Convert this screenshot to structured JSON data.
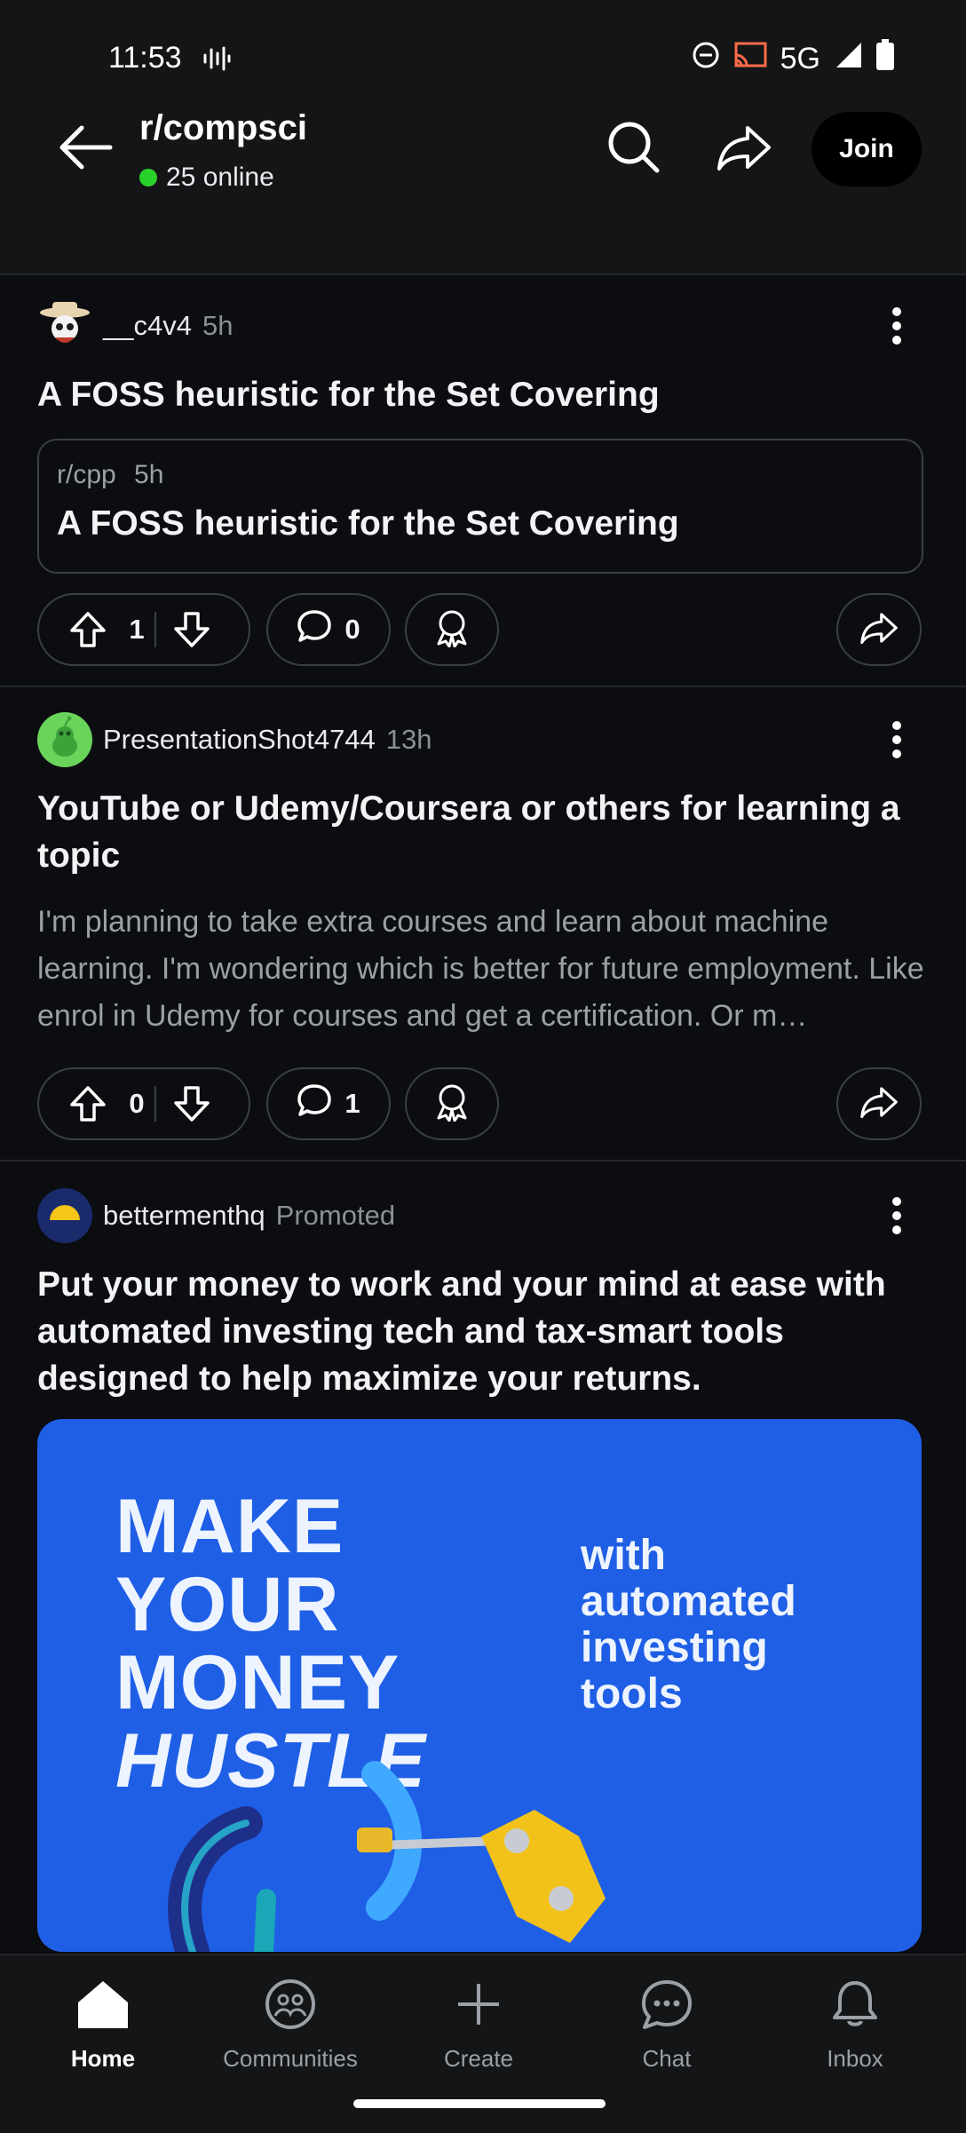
{
  "status_bar": {
    "time": "11:53",
    "network": "5G"
  },
  "header": {
    "community": "r/compsci",
    "online": "25 online",
    "join_label": "Join",
    "icons": [
      "back-arrow-icon",
      "search-icon",
      "share-icon"
    ]
  },
  "posts": [
    {
      "username": "__c4v4",
      "time": "5h",
      "title": "A FOSS heuristic for the Set Covering",
      "crosspost": {
        "subreddit": "r/cpp",
        "time": "5h",
        "title": "A FOSS heuristic for the Set Covering"
      },
      "votes": "1",
      "comments": "0"
    },
    {
      "username": "PresentationShot4744",
      "time": "13h",
      "title": "YouTube or Udemy/Coursera or others for learning a topic",
      "body": "I'm planning to take extra courses and learn about machine learning. I'm wondering which is better for future employment. Like enrol in Udemy for courses and get a certification. Or m…",
      "votes": "0",
      "comments": "1"
    },
    {
      "username": "bettermenthq",
      "tag": "Promoted",
      "title": "Put your money to work and your mind at ease with automated investing tech and tax-smart tools designed to help maximize your returns.",
      "ad": {
        "headline_lines": [
          "MAKE",
          "YOUR",
          "MONEY",
          "HUSTLE"
        ],
        "side_lines": [
          "with",
          "automated",
          "investing",
          "tools"
        ]
      }
    }
  ],
  "bottom_nav": {
    "tabs": [
      {
        "label": "Home",
        "icon": "home-icon",
        "active": true
      },
      {
        "label": "Communities",
        "icon": "communities-icon"
      },
      {
        "label": "Create",
        "icon": "plus-icon"
      },
      {
        "label": "Chat",
        "icon": "chat-icon"
      },
      {
        "label": "Inbox",
        "icon": "bell-icon"
      }
    ]
  },
  "colors": {
    "background": "#0b0d10",
    "online": "#2bd12b",
    "ad_blue": "#1f5fe6"
  }
}
